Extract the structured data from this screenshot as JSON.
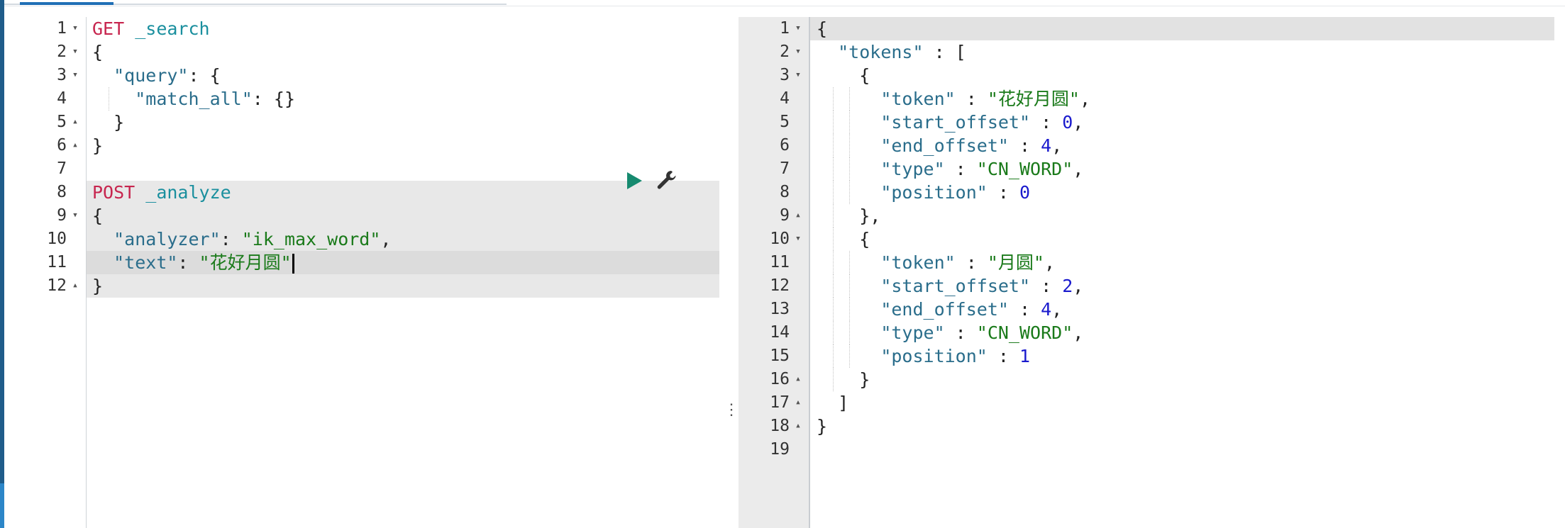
{
  "request_editor": {
    "lines": [
      {
        "n": "1",
        "fold": "down",
        "tokens": [
          {
            "t": "GET",
            "c": "tok-method"
          },
          {
            "t": " ",
            "c": "tok-pun"
          },
          {
            "t": "_search",
            "c": "tok-url"
          }
        ]
      },
      {
        "n": "2",
        "fold": "down",
        "tokens": [
          {
            "t": "{",
            "c": "tok-pun"
          }
        ]
      },
      {
        "n": "3",
        "fold": "down",
        "tokens": [
          {
            "t": "  ",
            "c": "tok-pun"
          },
          {
            "t": "\"query\"",
            "c": "tok-key"
          },
          {
            "t": ": {",
            "c": "tok-pun"
          }
        ]
      },
      {
        "n": "4",
        "fold": "",
        "tokens": [
          {
            "t": "    ",
            "c": "tok-pun"
          },
          {
            "t": "\"match_all\"",
            "c": "tok-key"
          },
          {
            "t": ": {}",
            "c": "tok-pun"
          }
        ]
      },
      {
        "n": "5",
        "fold": "up",
        "tokens": [
          {
            "t": "  }",
            "c": "tok-pun"
          }
        ]
      },
      {
        "n": "6",
        "fold": "up",
        "tokens": [
          {
            "t": "}",
            "c": "tok-pun"
          }
        ]
      },
      {
        "n": "7",
        "fold": "",
        "tokens": []
      },
      {
        "n": "8",
        "fold": "",
        "tokens": [
          {
            "t": "POST",
            "c": "tok-method"
          },
          {
            "t": " ",
            "c": "tok-pun"
          },
          {
            "t": "_analyze",
            "c": "tok-url"
          }
        ]
      },
      {
        "n": "9",
        "fold": "down",
        "tokens": [
          {
            "t": "{",
            "c": "tok-pun"
          }
        ]
      },
      {
        "n": "10",
        "fold": "",
        "tokens": [
          {
            "t": "  ",
            "c": "tok-pun"
          },
          {
            "t": "\"analyzer\"",
            "c": "tok-key"
          },
          {
            "t": ": ",
            "c": "tok-pun"
          },
          {
            "t": "\"ik_max_word\"",
            "c": "tok-str"
          },
          {
            "t": ",",
            "c": "tok-pun"
          }
        ]
      },
      {
        "n": "11",
        "fold": "",
        "tokens": [
          {
            "t": "  ",
            "c": "tok-pun"
          },
          {
            "t": "\"text\"",
            "c": "tok-key"
          },
          {
            "t": ": ",
            "c": "tok-pun"
          },
          {
            "t": "\"花好月圆\"",
            "c": "tok-str"
          }
        ],
        "cursor": true
      },
      {
        "n": "12",
        "fold": "up",
        "tokens": [
          {
            "t": "}",
            "c": "tok-pun"
          }
        ]
      }
    ]
  },
  "response_editor": {
    "lines": [
      {
        "n": "1",
        "fold": "down",
        "tokens": [
          {
            "t": "{",
            "c": "tok-pun"
          }
        ]
      },
      {
        "n": "2",
        "fold": "down",
        "tokens": [
          {
            "t": "  ",
            "c": "tok-pun"
          },
          {
            "t": "\"tokens\"",
            "c": "tok-key"
          },
          {
            "t": " : [",
            "c": "tok-pun"
          }
        ]
      },
      {
        "n": "3",
        "fold": "down",
        "tokens": [
          {
            "t": "    {",
            "c": "tok-pun"
          }
        ]
      },
      {
        "n": "4",
        "fold": "",
        "tokens": [
          {
            "t": "      ",
            "c": "tok-pun"
          },
          {
            "t": "\"token\"",
            "c": "tok-key"
          },
          {
            "t": " : ",
            "c": "tok-pun"
          },
          {
            "t": "\"花好月圆\"",
            "c": "tok-str"
          },
          {
            "t": ",",
            "c": "tok-pun"
          }
        ]
      },
      {
        "n": "5",
        "fold": "",
        "tokens": [
          {
            "t": "      ",
            "c": "tok-pun"
          },
          {
            "t": "\"start_offset\"",
            "c": "tok-key"
          },
          {
            "t": " : ",
            "c": "tok-pun"
          },
          {
            "t": "0",
            "c": "tok-num"
          },
          {
            "t": ",",
            "c": "tok-pun"
          }
        ]
      },
      {
        "n": "6",
        "fold": "",
        "tokens": [
          {
            "t": "      ",
            "c": "tok-pun"
          },
          {
            "t": "\"end_offset\"",
            "c": "tok-key"
          },
          {
            "t": " : ",
            "c": "tok-pun"
          },
          {
            "t": "4",
            "c": "tok-num"
          },
          {
            "t": ",",
            "c": "tok-pun"
          }
        ]
      },
      {
        "n": "7",
        "fold": "",
        "tokens": [
          {
            "t": "      ",
            "c": "tok-pun"
          },
          {
            "t": "\"type\"",
            "c": "tok-key"
          },
          {
            "t": " : ",
            "c": "tok-pun"
          },
          {
            "t": "\"CN_WORD\"",
            "c": "tok-str"
          },
          {
            "t": ",",
            "c": "tok-pun"
          }
        ]
      },
      {
        "n": "8",
        "fold": "",
        "tokens": [
          {
            "t": "      ",
            "c": "tok-pun"
          },
          {
            "t": "\"position\"",
            "c": "tok-key"
          },
          {
            "t": " : ",
            "c": "tok-pun"
          },
          {
            "t": "0",
            "c": "tok-num"
          }
        ]
      },
      {
        "n": "9",
        "fold": "up",
        "tokens": [
          {
            "t": "    },",
            "c": "tok-pun"
          }
        ]
      },
      {
        "n": "10",
        "fold": "down",
        "tokens": [
          {
            "t": "    {",
            "c": "tok-pun"
          }
        ]
      },
      {
        "n": "11",
        "fold": "",
        "tokens": [
          {
            "t": "      ",
            "c": "tok-pun"
          },
          {
            "t": "\"token\"",
            "c": "tok-key"
          },
          {
            "t": " : ",
            "c": "tok-pun"
          },
          {
            "t": "\"月圆\"",
            "c": "tok-str"
          },
          {
            "t": ",",
            "c": "tok-pun"
          }
        ]
      },
      {
        "n": "12",
        "fold": "",
        "tokens": [
          {
            "t": "      ",
            "c": "tok-pun"
          },
          {
            "t": "\"start_offset\"",
            "c": "tok-key"
          },
          {
            "t": " : ",
            "c": "tok-pun"
          },
          {
            "t": "2",
            "c": "tok-num"
          },
          {
            "t": ",",
            "c": "tok-pun"
          }
        ]
      },
      {
        "n": "13",
        "fold": "",
        "tokens": [
          {
            "t": "      ",
            "c": "tok-pun"
          },
          {
            "t": "\"end_offset\"",
            "c": "tok-key"
          },
          {
            "t": " : ",
            "c": "tok-pun"
          },
          {
            "t": "4",
            "c": "tok-num"
          },
          {
            "t": ",",
            "c": "tok-pun"
          }
        ]
      },
      {
        "n": "14",
        "fold": "",
        "tokens": [
          {
            "t": "      ",
            "c": "tok-pun"
          },
          {
            "t": "\"type\"",
            "c": "tok-key"
          },
          {
            "t": " : ",
            "c": "tok-pun"
          },
          {
            "t": "\"CN_WORD\"",
            "c": "tok-str"
          },
          {
            "t": ",",
            "c": "tok-pun"
          }
        ]
      },
      {
        "n": "15",
        "fold": "",
        "tokens": [
          {
            "t": "      ",
            "c": "tok-pun"
          },
          {
            "t": "\"position\"",
            "c": "tok-key"
          },
          {
            "t": " : ",
            "c": "tok-pun"
          },
          {
            "t": "1",
            "c": "tok-num"
          }
        ]
      },
      {
        "n": "16",
        "fold": "up",
        "tokens": [
          {
            "t": "    }",
            "c": "tok-pun"
          }
        ]
      },
      {
        "n": "17",
        "fold": "up",
        "tokens": [
          {
            "t": "  ]",
            "c": "tok-pun"
          }
        ]
      },
      {
        "n": "18",
        "fold": "up",
        "tokens": [
          {
            "t": "}",
            "c": "tok-pun"
          }
        ]
      },
      {
        "n": "19",
        "fold": "",
        "tokens": []
      }
    ]
  },
  "actions": {
    "play_icon": "play-icon",
    "wrench_icon": "wrench-icon",
    "play_color": "#168a6f",
    "wrench_color": "#333333"
  },
  "colors": {
    "method": "#c7254e",
    "url": "#1a8f9e",
    "key": "#2a6d8b",
    "string": "#1a7a1a",
    "number": "#1a1acd"
  }
}
